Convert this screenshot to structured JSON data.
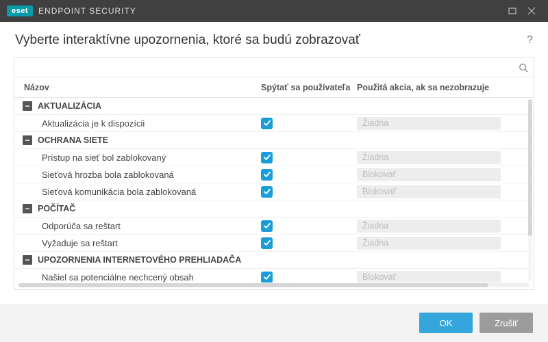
{
  "brand": {
    "badge": "eset",
    "product": "ENDPOINT SECURITY"
  },
  "headline": "Vyberte interaktívne upozornenia, ktoré sa budú zobrazovať",
  "columns": {
    "name": "Názov",
    "ask": "Spýtať sa používateľa",
    "action": "Použitá akcia, ak sa nezobrazuje"
  },
  "search": {
    "placeholder": ""
  },
  "groups": [
    {
      "label": "AKTUALIZÁCIA",
      "items": [
        {
          "label": "Aktualizácia je k dispozícii",
          "ask": true,
          "action": "Žiadna"
        }
      ]
    },
    {
      "label": "OCHRANA SIETE",
      "items": [
        {
          "label": "Prístup na sieť bol zablokovaný",
          "ask": true,
          "action": "Žiadna"
        },
        {
          "label": "Sieťová hrozba bola zablokovaná",
          "ask": true,
          "action": "Blokovať"
        },
        {
          "label": "Sieťová komunikácia bola zablokovaná",
          "ask": true,
          "action": "Blokovať"
        }
      ]
    },
    {
      "label": "POČÍTAČ",
      "items": [
        {
          "label": "Odporúča sa reštart",
          "ask": true,
          "action": "Žiadna"
        },
        {
          "label": "Vyžaduje sa reštart",
          "ask": true,
          "action": "Žiadna"
        }
      ]
    },
    {
      "label": "UPOZORNENIA INTERNETOVÉHO PREHLIADAČA",
      "items": [
        {
          "label": "Našiel sa potenciálne nechcený obsah",
          "ask": true,
          "action": "Blokovať"
        }
      ]
    }
  ],
  "buttons": {
    "ok": "OK",
    "cancel": "Zrušiť"
  }
}
